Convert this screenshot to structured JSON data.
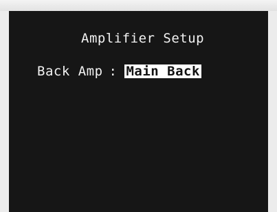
{
  "osd": {
    "title": "Amplifier Setup",
    "setting": {
      "label": "Back Amp",
      "separator": ":",
      "value": "Main Back"
    }
  },
  "colors": {
    "panel_background": "#161616",
    "text": "#f2f2f2",
    "highlight_background": "#ffffff",
    "highlight_text": "#111111",
    "frame": "#ececec"
  }
}
